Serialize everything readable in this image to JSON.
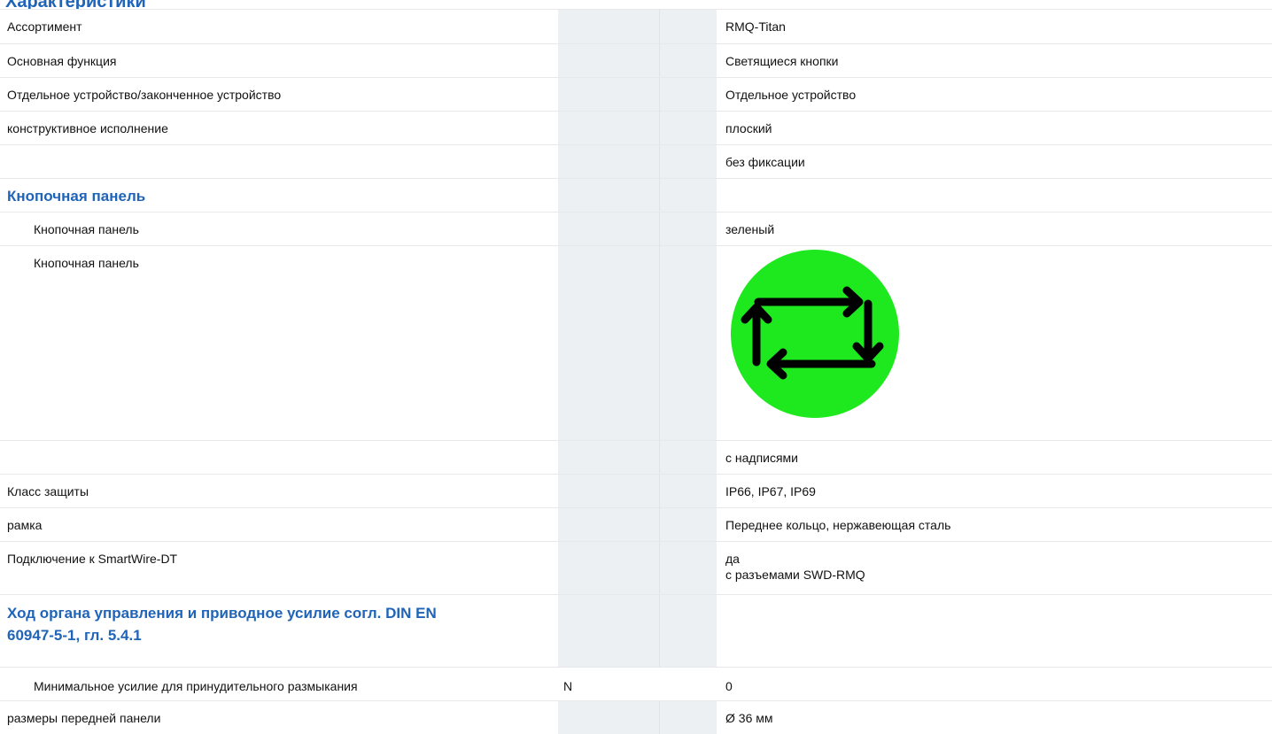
{
  "page": {
    "cut_title": "Характеристики"
  },
  "rows": [
    {
      "label": "Ассортимент",
      "unit": "",
      "value": "RMQ-Titan"
    },
    {
      "label": "Основная функция",
      "unit": "",
      "value": "Светящиеся кнопки"
    },
    {
      "label": "Отдельное устройство/законченное устройство",
      "unit": "",
      "value": "Отдельное устройство"
    },
    {
      "label": "конструктивное исполнение",
      "unit": "",
      "value": "плоский"
    },
    {
      "label": "",
      "unit": "",
      "value": "без фиксации"
    }
  ],
  "section_button": {
    "heading": "Кнопочная панель",
    "color_label": "Кнопочная панель",
    "color_value": "зеленый",
    "symbol_label": "Кнопочная панель",
    "symbol_icon": "green-cycle-arrows-icon",
    "colors": {
      "disc": "#1ee81e",
      "arrows": "#000000"
    }
  },
  "rows2": [
    {
      "label": "",
      "unit": "",
      "value": "с надписями"
    },
    {
      "label": "Класс защиты",
      "unit": "",
      "value": "IP66, IP67, IP69"
    },
    {
      "label": "рамка",
      "unit": "",
      "value": "Переднее кольцо, нержавеющая сталь"
    },
    {
      "label": "Подключение к SmartWire-DT",
      "unit": "",
      "value_line1": "да",
      "value_line2": "с разъемами SWD-RMQ"
    }
  ],
  "section_force": {
    "heading_line1": "Ход органа управления и приводное усилие согл. DIN EN",
    "heading_line2": "60947-5-1, гл. 5.4.1",
    "min_force_label": "Минимальное усилие для принудительного размыкания",
    "min_force_unit": "N",
    "min_force_value": "0"
  },
  "last_row": {
    "label": "размеры передней панели",
    "unit": "",
    "value": "Ø 36 мм"
  },
  "colors": {
    "accent": "#1f64b8",
    "unit_bg": "#edf0f3",
    "border": "#e6e8ec"
  }
}
